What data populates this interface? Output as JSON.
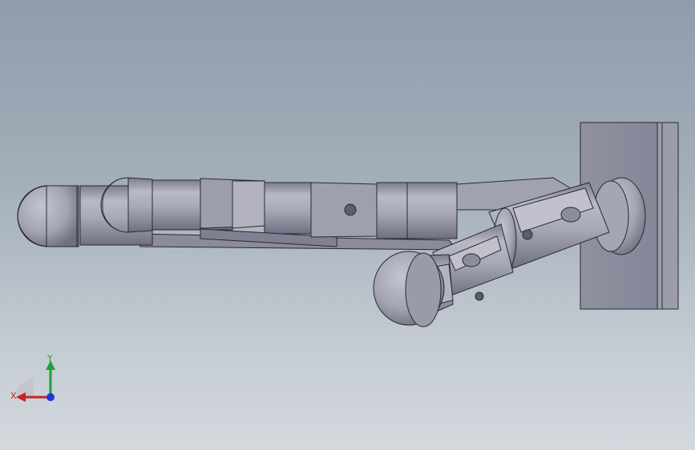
{
  "viewport": {
    "background_top": "#8f9dab",
    "background_bottom": "#d4d9de"
  },
  "model": {
    "part_color": "#a9aab8",
    "part_shadow": "#7c7d8d",
    "edge_color": "#2a2a33",
    "mount_color": "#8e8fa0"
  },
  "triad": {
    "x_label": "X",
    "y_label": "Y",
    "x_color": "#c8202a",
    "y_color": "#1aa33a",
    "z_color": "#1f37d6"
  }
}
